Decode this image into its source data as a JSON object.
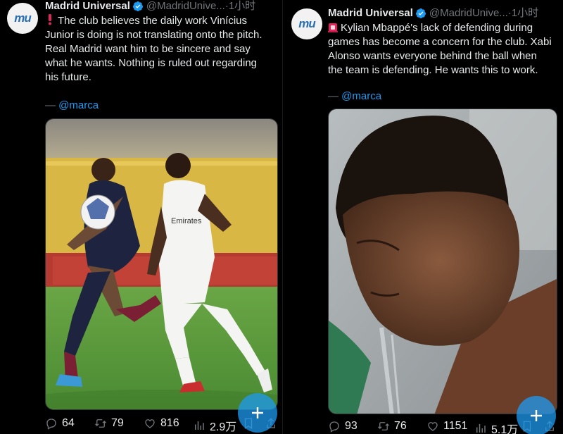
{
  "left": {
    "account": {
      "name": "Madrid Universal",
      "handle": "@MadridUnive...",
      "separator": "·",
      "time": "1小时",
      "avatar_text": "mu"
    },
    "text": [
      "The club believes the daily work Vinícius",
      "Junior is doing is not translating onto the pitch.",
      "Real Madrid want him to be sincere and say",
      "what he wants. Nothing is ruled out regarding",
      "his future."
    ],
    "source": {
      "dash": "—",
      "mention": "@marca"
    },
    "emoji": "exclamation-icon",
    "metrics": {
      "replies": "64",
      "reposts": "79",
      "likes": "816",
      "views": "2.9万"
    }
  },
  "right": {
    "account": {
      "name": "Madrid Universal",
      "handle": "@MadridUnive...",
      "separator": "·",
      "time": "1小时",
      "avatar_text": "mu"
    },
    "text": [
      "Kylian Mbappé's lack of defending during",
      "games has become a concern for the club. Xabi",
      "Alonso wants everyone behind the ball when",
      "the team is defending. He wants this to work."
    ],
    "source": {
      "dash": "—",
      "mention": "@marca"
    },
    "emoji": "siren-icon",
    "metrics": {
      "replies": "93",
      "reposts": "76",
      "likes": "1151",
      "views": "5.1万"
    }
  },
  "colors": {
    "accent": "#1d9bf0",
    "text": "#e7e9ea",
    "muted": "#71767b",
    "background": "#000000"
  }
}
